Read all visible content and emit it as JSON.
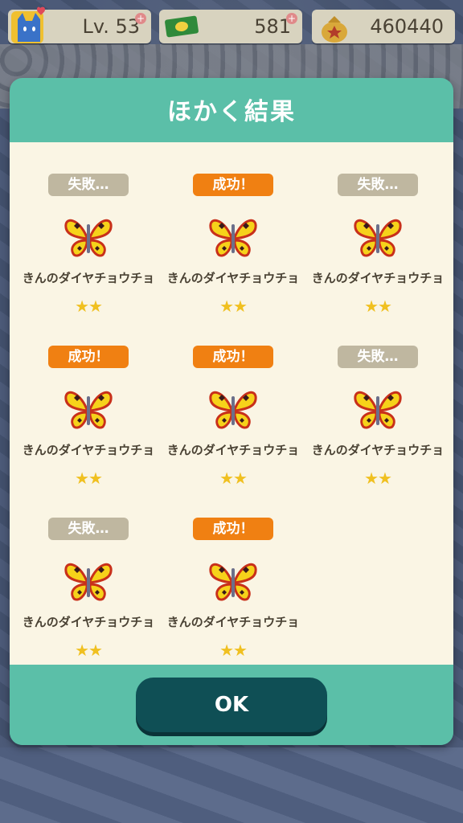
{
  "topbar": {
    "level": "Lv. 53",
    "tickets": "581",
    "bells": "460440"
  },
  "modal": {
    "title": "ほかく結果",
    "ok_label": "OK",
    "results": [
      {
        "status": "fail",
        "badge": "失敗…",
        "name": "きんのダイヤチョウチョ",
        "stars": "★★"
      },
      {
        "status": "success",
        "badge": "成功！",
        "name": "きんのダイヤチョウチョ",
        "stars": "★★"
      },
      {
        "status": "fail",
        "badge": "失敗…",
        "name": "きんのダイヤチョウチョ",
        "stars": "★★"
      },
      {
        "status": "success",
        "badge": "成功！",
        "name": "きんのダイヤチョウチョ",
        "stars": "★★"
      },
      {
        "status": "success",
        "badge": "成功！",
        "name": "きんのダイヤチョウチョ",
        "stars": "★★"
      },
      {
        "status": "fail",
        "badge": "失敗…",
        "name": "きんのダイヤチョウチョ",
        "stars": "★★"
      },
      {
        "status": "fail",
        "badge": "失敗…",
        "name": "きんのダイヤチョウチョ",
        "stars": "★★"
      },
      {
        "status": "success",
        "badge": "成功！",
        "name": "きんのダイヤチョウチョ",
        "stars": "★★"
      }
    ]
  },
  "colors": {
    "accent": "#5bbfa8",
    "success": "#f08012",
    "fail": "#bfb7a0",
    "button": "#0f4f55",
    "panel": "#faf5e4"
  },
  "icons": {
    "avatar": "cat-avatar-icon",
    "tickets": "leaf-ticket-icon",
    "bells": "bell-bag-icon",
    "item": "butterfly-icon"
  }
}
